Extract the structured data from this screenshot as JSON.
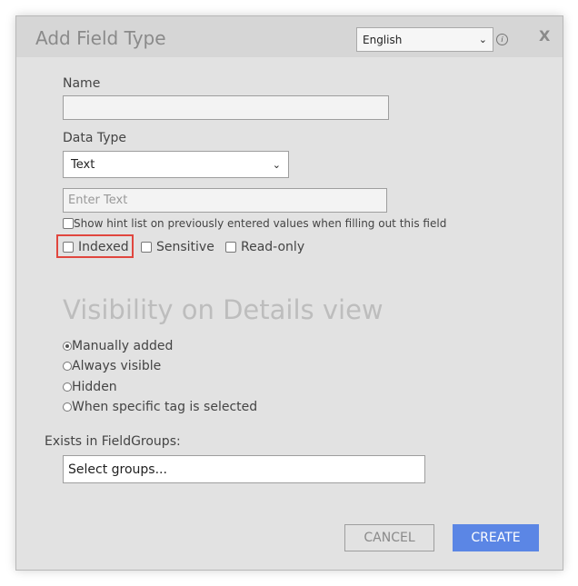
{
  "dialog": {
    "title": "Add Field Type",
    "language": "English",
    "help_icon": "info-icon",
    "close_label": "X"
  },
  "form": {
    "name_label": "Name",
    "name_value": "",
    "data_type_label": "Data Type",
    "data_type_value": "Text",
    "enter_text_placeholder": "Enter Text",
    "hint_checkbox_label": "Show hint list on previously entered values when filling out this field",
    "indexed_label": "Indexed",
    "sensitive_label": "Sensitive",
    "readonly_label": "Read-only"
  },
  "visibility": {
    "title": "Visibility on Details view",
    "options": [
      {
        "label": "Manually added",
        "checked": true
      },
      {
        "label": "Always visible",
        "checked": false
      },
      {
        "label": "Hidden",
        "checked": false
      },
      {
        "label": "When specific tag is selected",
        "checked": false
      }
    ]
  },
  "groups": {
    "label": "Exists in FieldGroups:",
    "placeholder": "Select groups..."
  },
  "buttons": {
    "cancel": "CANCEL",
    "create": "CREATE"
  },
  "colors": {
    "accent": "#5b86e5",
    "highlight": "#e0463e"
  }
}
